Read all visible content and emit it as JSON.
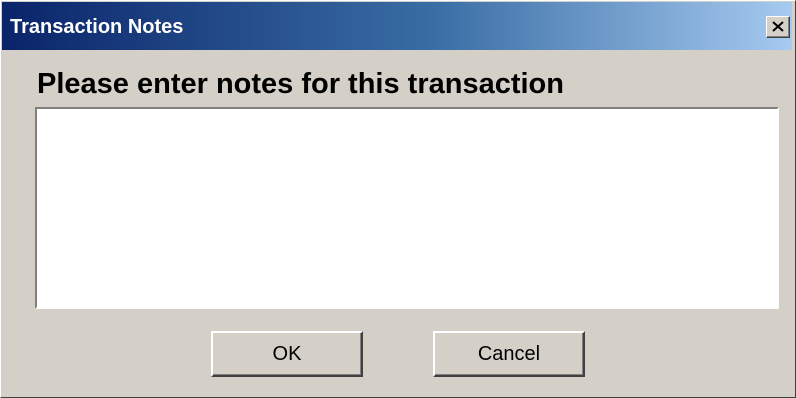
{
  "window": {
    "title": "Transaction Notes",
    "close_icon": "close-x",
    "titlebar_colors": [
      "#0a246a",
      "#a6caf0"
    ]
  },
  "dialog": {
    "prompt": "Please enter notes for this transaction",
    "notes": {
      "value": "",
      "placeholder": ""
    }
  },
  "buttons": {
    "ok_label": "OK",
    "cancel_label": "Cancel"
  }
}
